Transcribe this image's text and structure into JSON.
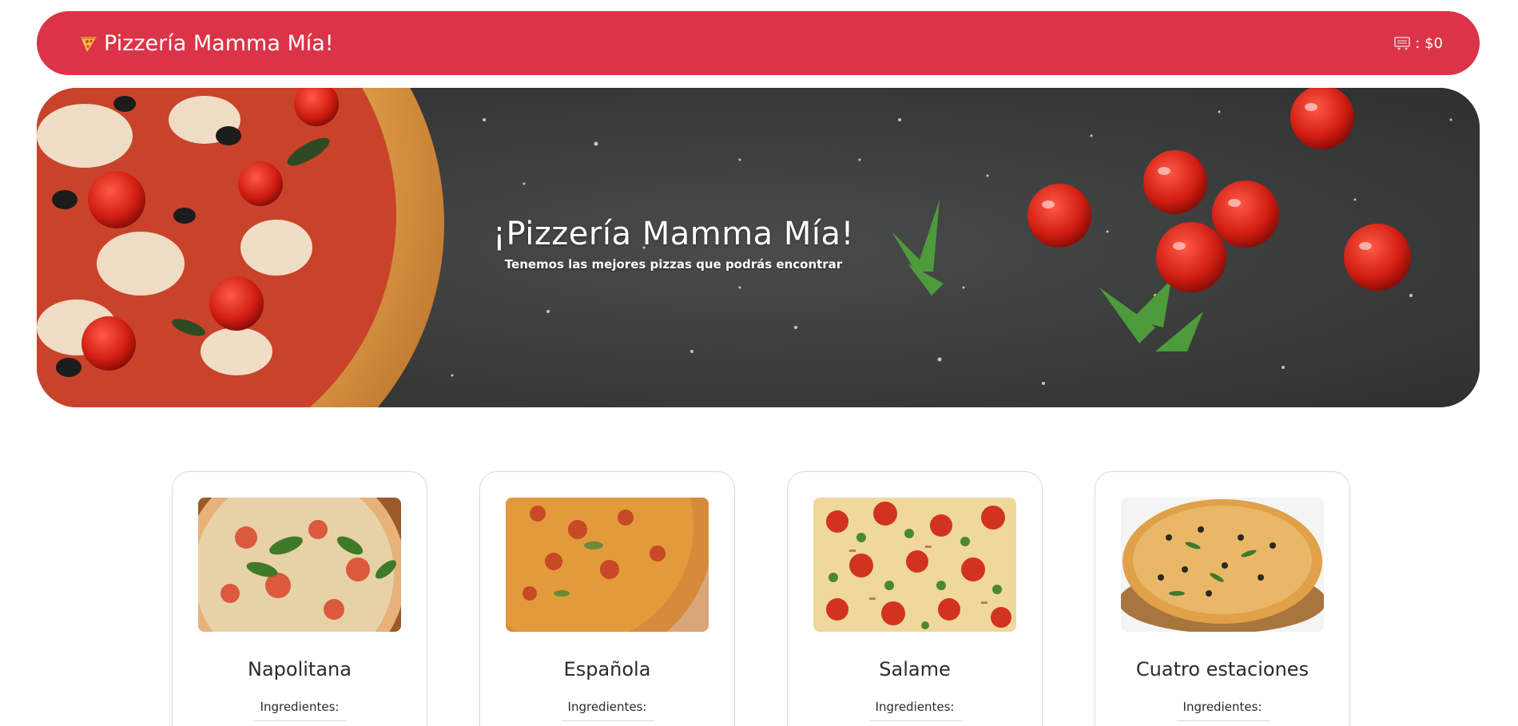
{
  "navbar": {
    "brand_label": "Pizzería Mamma Mía!",
    "brand_icon": "pizza-slice-icon",
    "cart_icon": "cart-icon",
    "cart_total": ": $0",
    "accent_color": "#db3348"
  },
  "hero": {
    "title": "¡Pizzería Mamma Mía!",
    "subtitle": "Tenemos las mejores pizzas que podrás encontrar"
  },
  "pizzas": [
    {
      "name": "Napolitana",
      "ingredients_label": "Ingredientes:"
    },
    {
      "name": "Española",
      "ingredients_label": "Ingredientes:"
    },
    {
      "name": "Salame",
      "ingredients_label": "Ingredientes:"
    },
    {
      "name": "Cuatro estaciones",
      "ingredients_label": "Ingredientes:"
    }
  ]
}
